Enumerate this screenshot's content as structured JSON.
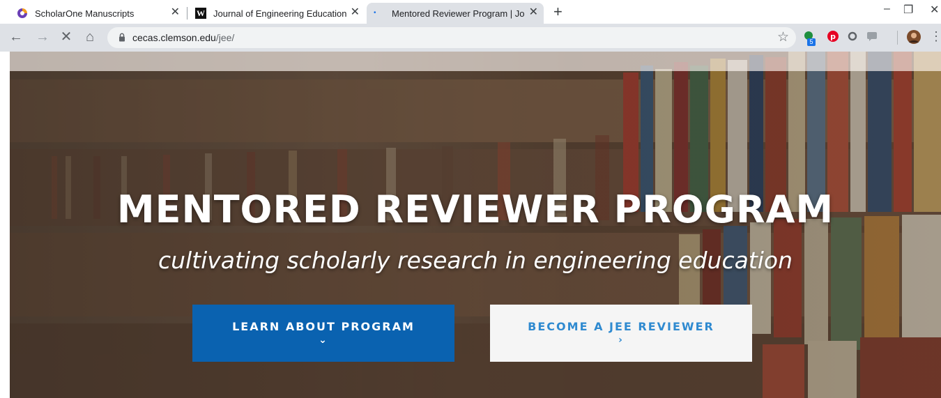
{
  "browser": {
    "tabs": [
      {
        "title": "ScholarOne Manuscripts",
        "active": false
      },
      {
        "title": "Journal of Engineering Education",
        "active": false
      },
      {
        "title": "Mentored Reviewer Program | Jo",
        "active": true
      }
    ],
    "new_tab_symbol": "+",
    "window_controls": {
      "minimize": "–",
      "restore": "❐",
      "close": "✕"
    },
    "address": {
      "domain": "cecas.clemson.edu",
      "path": "/jee/"
    },
    "extension_badge": "5",
    "icons": [
      "back-icon",
      "forward-icon",
      "stop-icon",
      "home-icon",
      "lock-icon",
      "bookmark-star-icon",
      "pinterest-icon",
      "profile-avatar-icon",
      "menu-icon"
    ]
  },
  "hero": {
    "title": "MENTORED REVIEWER PROGRAM",
    "subtitle": "cultivating scholarly research in engineering education",
    "buttons": {
      "learn": {
        "label": "LEARN ABOUT PROGRAM",
        "icon": "⌄"
      },
      "become": {
        "label": "BECOME A JEE REVIEWER",
        "icon": "›"
      }
    }
  },
  "colors": {
    "primary_button": "#0a62b0",
    "secondary_button_text": "#2f8ad0",
    "secondary_button_bg": "#f5f5f5",
    "toolbar": "#dee1e6"
  }
}
